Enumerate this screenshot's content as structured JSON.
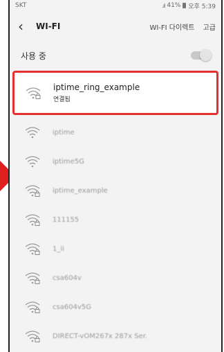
{
  "status_bar": {
    "carrier": "SKT",
    "signal": ".ıl",
    "battery_percent": "41%",
    "time": "오후 5:39"
  },
  "header": {
    "back_icon": "chevron-left-icon",
    "title": "WI-FI",
    "wifi_direct_label": "WI-FI 다이렉트",
    "advanced_label": "고급"
  },
  "in_use": {
    "label": "사용 중",
    "toggle_on": false
  },
  "networks": [
    {
      "name": "iptime_ring_example",
      "status": "연결됨",
      "secured": true,
      "connected": true
    },
    {
      "name": "iptime",
      "status": "",
      "secured": false
    },
    {
      "name": "iptime5G",
      "status": "",
      "secured": false
    },
    {
      "name": "iptime_example",
      "status": "",
      "secured": true
    },
    {
      "name": "111155",
      "status": "",
      "secured": true
    },
    {
      "name": "1_ii",
      "status": "",
      "secured": true
    },
    {
      "name": "csa604v",
      "status": "",
      "secured": true
    },
    {
      "name": "csa604v5G",
      "status": "",
      "secured": true
    },
    {
      "name": "DIRECT-vOM267x 287x Ser.",
      "status": "",
      "secured": true
    }
  ],
  "colors": {
    "highlight": "#e53030",
    "arrow": "#e01f1f"
  }
}
